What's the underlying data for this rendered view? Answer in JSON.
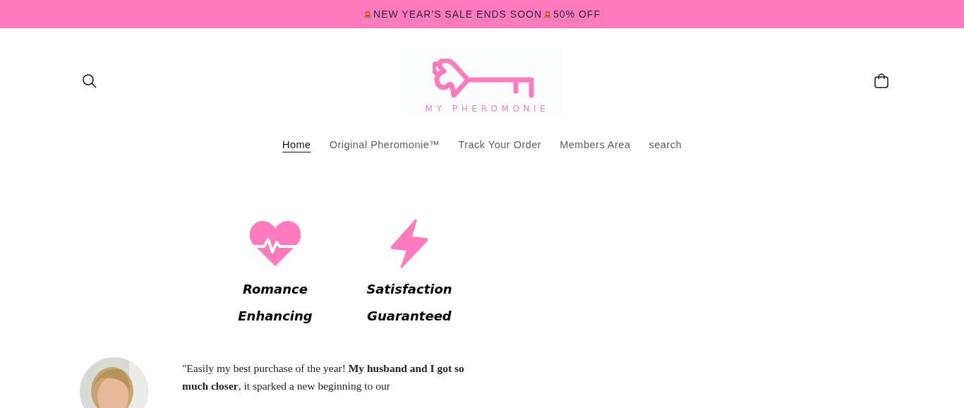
{
  "announcement": {
    "parts": [
      "NEW YEAR'S SALE ENDS SOON",
      "50% OFF"
    ]
  },
  "header": {
    "logo_text": "MY PHEROMONIE"
  },
  "nav": [
    {
      "label": "Home",
      "selected": true
    },
    {
      "label": "Original Pheromonie™",
      "selected": false
    },
    {
      "label": "Track Your Order",
      "selected": false
    },
    {
      "label": "Members Area",
      "selected": false
    },
    {
      "label": "search",
      "selected": false
    }
  ],
  "features": [
    {
      "kind": "heartbeat",
      "lines": [
        "Romance",
        "Enhancing"
      ]
    },
    {
      "kind": "bolt",
      "lines": [
        "Satisfaction",
        "Guaranteed"
      ]
    }
  ],
  "testimonial": {
    "quote": "\"Easily my best purchase of the year! **My husband and I got so much closer**, it sparked a new beginning to our"
  }
}
